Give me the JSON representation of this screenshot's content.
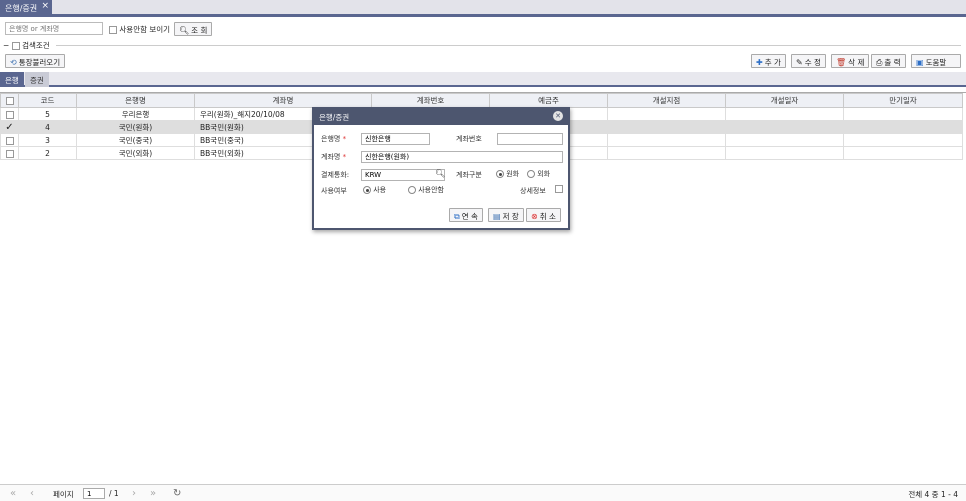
{
  "tabstrip": {
    "active_tab": "은행/증권",
    "close_glyph": "×"
  },
  "search": {
    "placeholder": "은행명 or 계좌명",
    "show_unused_label": "사용안함 보이기",
    "query_button": "조 회"
  },
  "conditions": {
    "label": "검색조건"
  },
  "toolbar": {
    "import_button": "통장불러오기",
    "add": "추 가",
    "edit": "수 정",
    "delete": "삭 제",
    "print": "출 력",
    "help": "도움말"
  },
  "subtabs": [
    "은행",
    "증권"
  ],
  "grid": {
    "columns": [
      "",
      "코드",
      "은행명",
      "계좌명",
      "계좌번호",
      "예금주",
      "개설지점",
      "개설일자",
      "만기일자"
    ],
    "rows": [
      {
        "checked": false,
        "selected": false,
        "code": "5",
        "bank": "우리은행",
        "account_name": "우리(원화)_해지20/10/08"
      },
      {
        "checked": true,
        "selected": true,
        "code": "4",
        "bank": "국민(원화)",
        "account_name": "BB국민(원화)"
      },
      {
        "checked": false,
        "selected": false,
        "code": "3",
        "bank": "국민(중국)",
        "account_name": "BB국민(중국)"
      },
      {
        "checked": false,
        "selected": false,
        "code": "2",
        "bank": "국민(외화)",
        "account_name": "BB국민(외화)"
      }
    ]
  },
  "footer": {
    "page_label": "페이지",
    "page_value": "1",
    "page_total": "/ 1",
    "total_text": "전체 4 중 1 - 4"
  },
  "dialog": {
    "title": "은행/증권",
    "bank_label": "은행명",
    "bank_value": "신한은행",
    "account_no_label": "계좌번호",
    "account_no_value": "",
    "account_name_label": "계좌명",
    "account_name_value": "신한은행(원화)",
    "currency_label": "결제통화:",
    "currency_value": "KRW",
    "account_type_label": "계좌구분",
    "type_won": "원화",
    "type_foreign": "외화",
    "use_label": "사용여부",
    "use_yes": "사용",
    "use_no": "사용안함",
    "detail_label": "상세정보",
    "continue_button": "연 속",
    "save_button": "저 장",
    "cancel_button": "취 소",
    "required_mark": "*"
  },
  "colors": {
    "accent": "#5a6690",
    "dialog_header": "#4d566f"
  }
}
